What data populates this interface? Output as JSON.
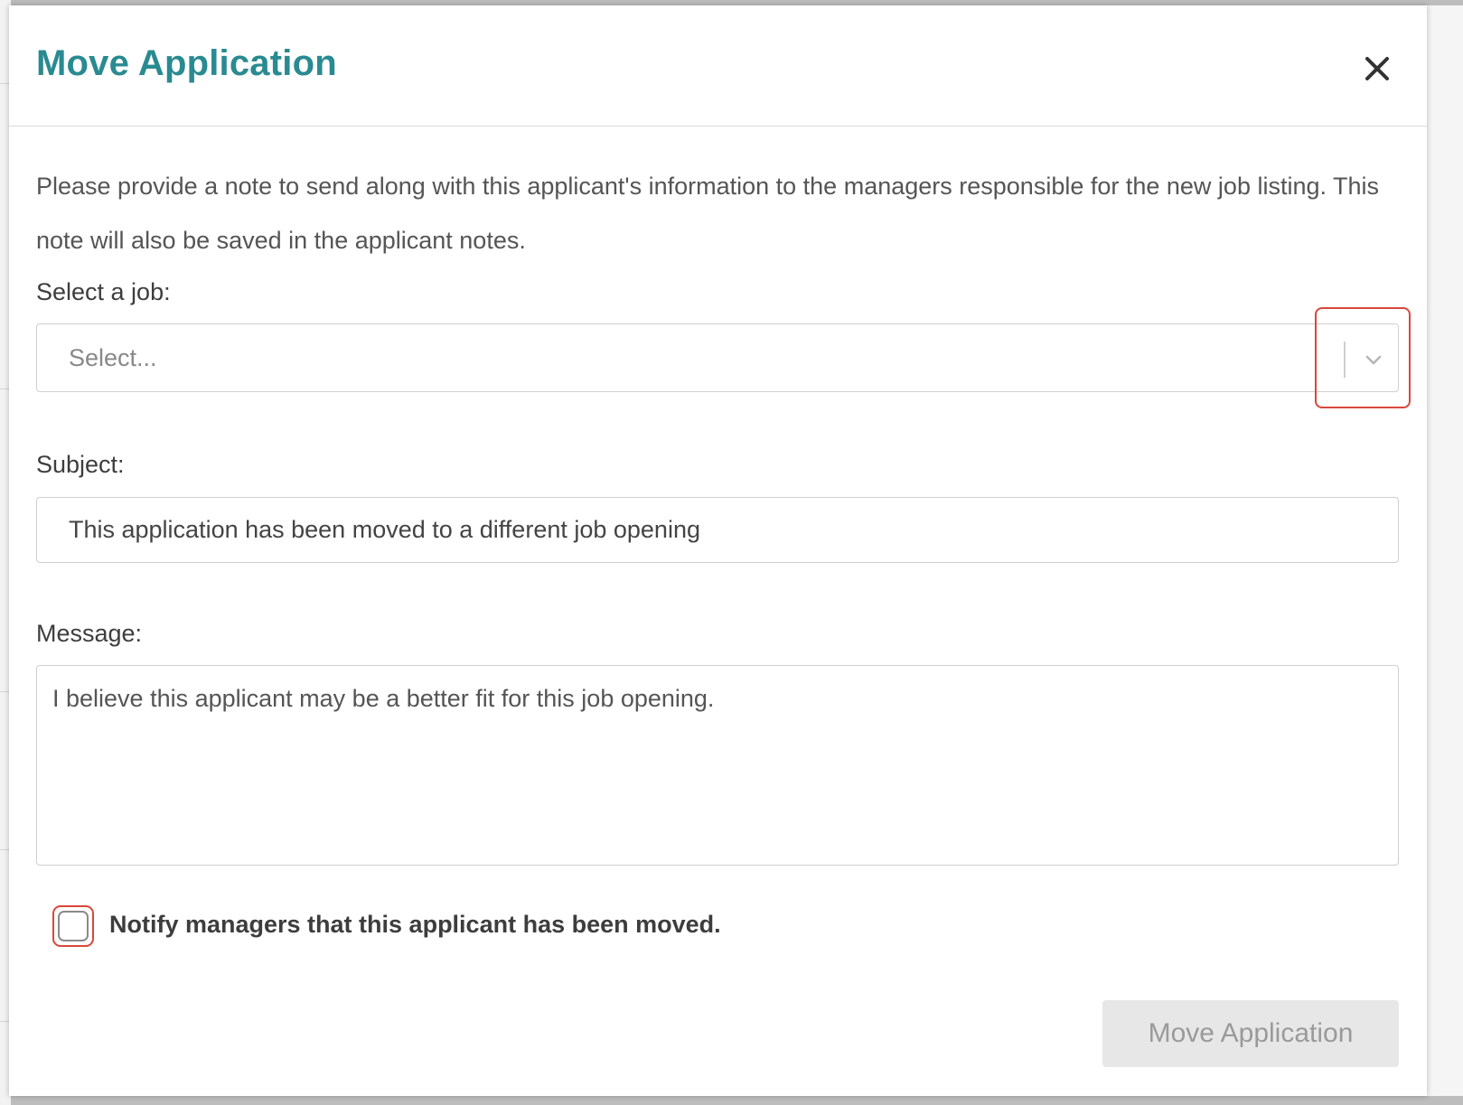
{
  "dialog": {
    "title": "Move Application",
    "close_icon": "close-icon",
    "intro": "Please provide a note to send along with this applicant's information to the managers responsible for the new job listing. This note will also be saved in the applicant notes."
  },
  "job_select": {
    "label": "Select a job:",
    "placeholder": "Select...",
    "chevron_icon": "chevron-down-icon"
  },
  "subject": {
    "label": "Subject:",
    "value": "This application has been moved to a different job opening"
  },
  "message": {
    "label": "Message:",
    "value": "I believe this applicant may be a better fit for this job opening."
  },
  "notify": {
    "label": "Notify managers that this applicant has been moved.",
    "checked": false
  },
  "actions": {
    "submit_label": "Move Application"
  },
  "colors": {
    "title": "#2a8a91",
    "highlight": "#d9473a",
    "disabled_button_bg": "#e7e7e7",
    "disabled_button_text": "#9a9a9a"
  }
}
